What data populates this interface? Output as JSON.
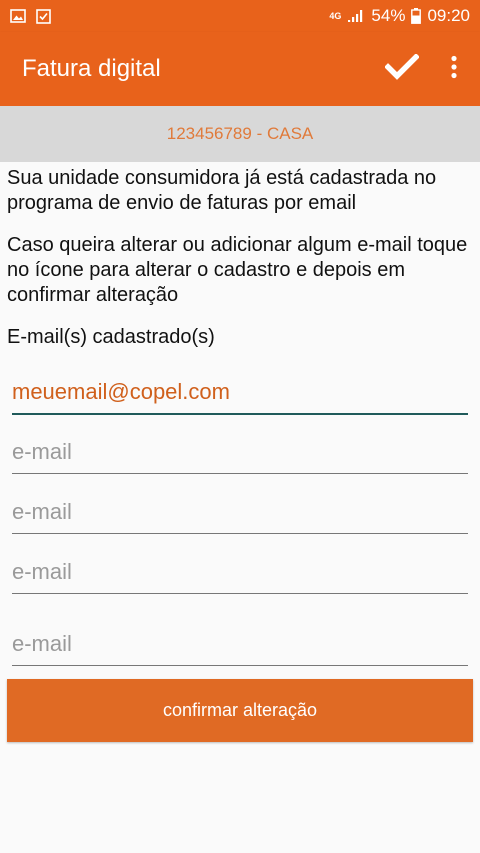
{
  "status_bar": {
    "network_type": "4G",
    "battery": "54%",
    "time": "09:20",
    "icons": [
      "gallery-icon",
      "checkbox-icon",
      "signal-icon",
      "battery-icon"
    ]
  },
  "app_bar": {
    "title": "Fatura digital",
    "actions": [
      "check-icon",
      "more-vert-icon"
    ]
  },
  "account": {
    "label": "123456789 - CASA"
  },
  "info": {
    "paragraph1": "Sua unidade consumidora já está cadastrada no programa de envio de faturas por email",
    "paragraph2": "Caso queira alterar ou adicionar algum e-mail toque no ícone para alterar o cadastro e depois em confirmar alteração",
    "emails_label": "E-mail(s) cadastrado(s)"
  },
  "emails": [
    {
      "value": "meuemail@copel.com",
      "placeholder": "e-mail"
    },
    {
      "value": "",
      "placeholder": "e-mail"
    },
    {
      "value": "",
      "placeholder": "e-mail"
    },
    {
      "value": "",
      "placeholder": "e-mail"
    },
    {
      "value": "",
      "placeholder": "e-mail"
    }
  ],
  "confirm_button": {
    "label": "confirmar alteração"
  },
  "colors": {
    "primary": "#e8621b",
    "accent_text": "#e07a3a",
    "subheader_bg": "#d8d8d8",
    "focus_underline": "#1f5a5a"
  }
}
